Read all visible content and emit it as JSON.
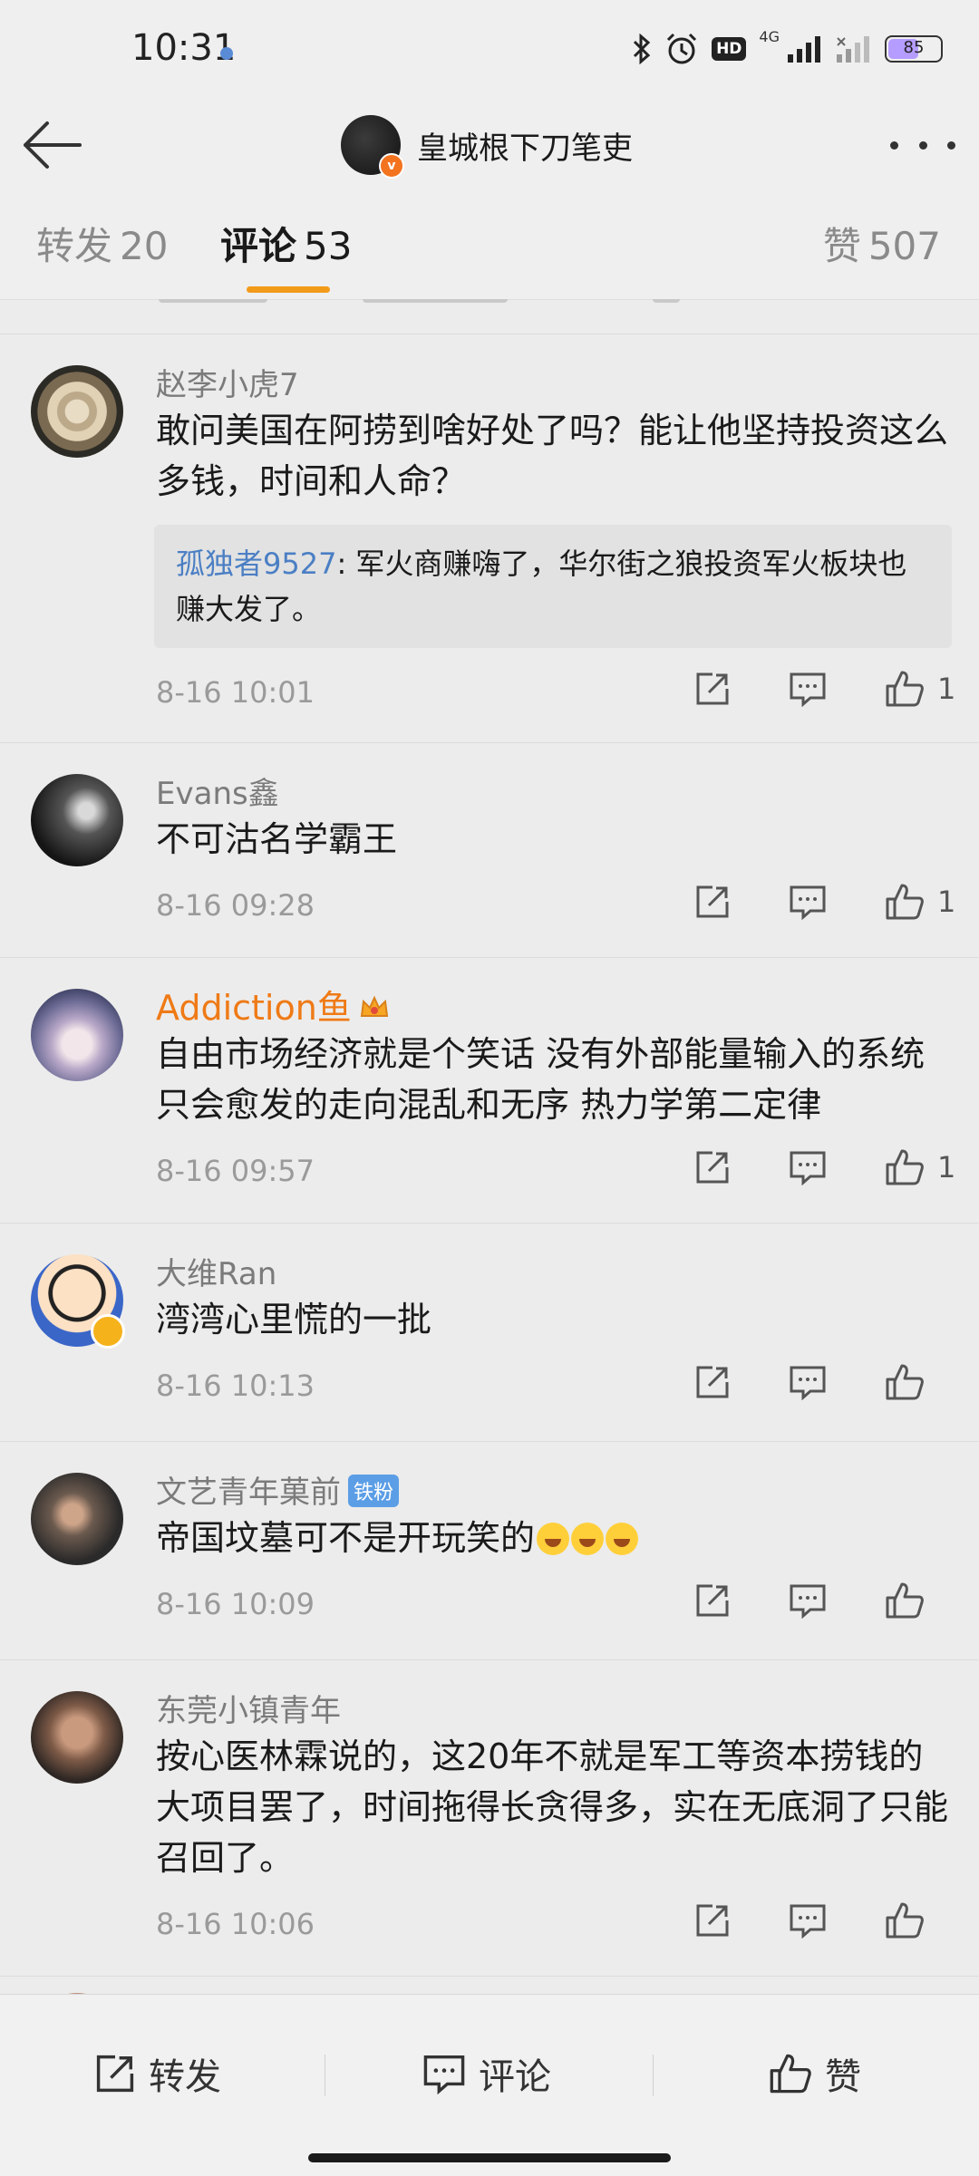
{
  "status_bar": {
    "time": "10:31",
    "network": "4G",
    "hd": "HD",
    "battery": "85",
    "icons": [
      "bluetooth-icon",
      "alarm-icon",
      "signal-icon",
      "wifi-icon",
      "battery-icon"
    ]
  },
  "header": {
    "title": "皇城根下刀笔吏",
    "verified_badge": "v"
  },
  "tabs": {
    "repost_label": "转发",
    "repost_count": "20",
    "comment_label": "评论",
    "comment_count": "53",
    "like_label": "赞",
    "like_count": "507"
  },
  "comments": [
    {
      "name": "赵李小虎7",
      "text": "敢问美国在阿捞到啥好处了吗？能让他坚持投资这么多钱，时间和人命？",
      "reply": {
        "name": "孤独者9527",
        "text": ": 军火商赚嗨了，华尔街之狼投资军火板块也赚大发了。"
      },
      "time": "8-16 10:01",
      "likes": "1"
    },
    {
      "name": "Evans鑫",
      "text": "不可沽名学霸王",
      "time": "8-16 09:28",
      "likes": "1"
    },
    {
      "name": "Addiction鱼",
      "text": "自由市场经济就是个笑话 没有外部能量输入的系统只会愈发的走向混乱和无序 热力学第二定律",
      "time": "8-16 09:57",
      "likes": "1"
    },
    {
      "name": "大维Ran",
      "text": "湾湾心里慌的一批",
      "time": "8-16 10:13",
      "likes": ""
    },
    {
      "name": "文艺青年菓前",
      "badge": "铁粉",
      "text": "帝国坟墓可不是开玩笑的",
      "time": "8-16 10:09",
      "likes": ""
    },
    {
      "name": "东莞小镇青年",
      "text": "按心医林霖说的，这20年不就是军工等资本捞钱的大项目罢了，时间拖得长贪得多，实在无底洞了只能召回了。",
      "time": "8-16 10:06",
      "likes": ""
    }
  ],
  "bottom_bar": {
    "repost": "转发",
    "comment": "评论",
    "like": "赞"
  },
  "colors": {
    "accent": "#f29a1a",
    "vip_name": "#ef7a16",
    "reply_name": "#4b7fc4",
    "fan_badge": "#5b9ee6"
  }
}
